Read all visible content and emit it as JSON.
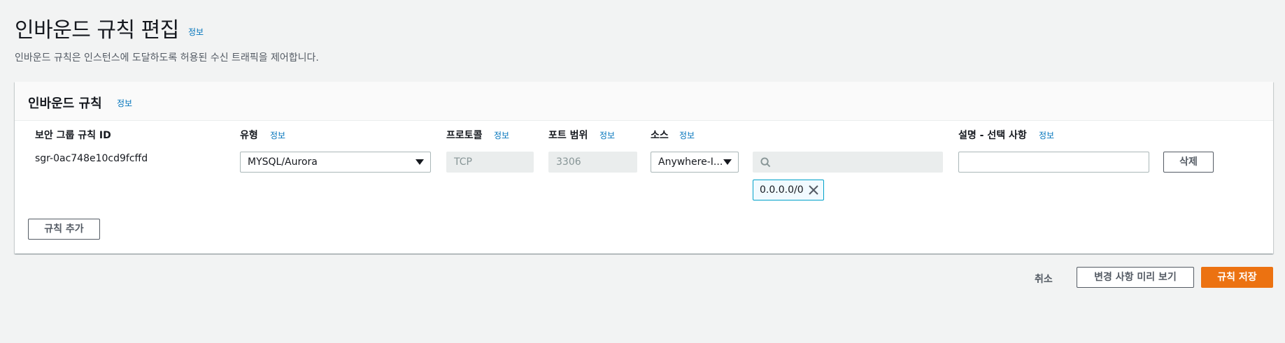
{
  "page": {
    "title": "인바운드 규칙 편집",
    "title_info": "정보",
    "description": "인바운드 규칙은 인스턴스에 도달하도록 허용된 수신 트래픽을 제어합니다."
  },
  "panel": {
    "title": "인바운드 규칙",
    "title_info": "정보",
    "columns": {
      "rule_id": "보안 그룹 규칙 ID",
      "type": "유형",
      "protocol": "프로토콜",
      "port_range": "포트 범위",
      "source": "소스",
      "description": "설명 - 선택 사항"
    },
    "info_label": "정보",
    "rule": {
      "id": "sgr-0ac748e10cd9fcffd",
      "type": "MYSQL/Aurora",
      "protocol": "TCP",
      "port_range": "3306",
      "source_type": "Anywhere-I...",
      "source_search_placeholder": "",
      "source_token": "0.0.0.0/0",
      "description_value": "",
      "delete_label": "삭제"
    },
    "add_rule_label": "규칙 추가"
  },
  "footer": {
    "cancel_label": "취소",
    "preview_label": "변경 사항 미리 보기",
    "save_label": "규칙 저장"
  },
  "colors": {
    "background": "#f2f3f3",
    "link": "#0073bb",
    "primary_button": "#ec7211",
    "token_border": "#00a1c9"
  },
  "icons": [
    "search-icon",
    "close-icon",
    "caret-down-icon"
  ]
}
